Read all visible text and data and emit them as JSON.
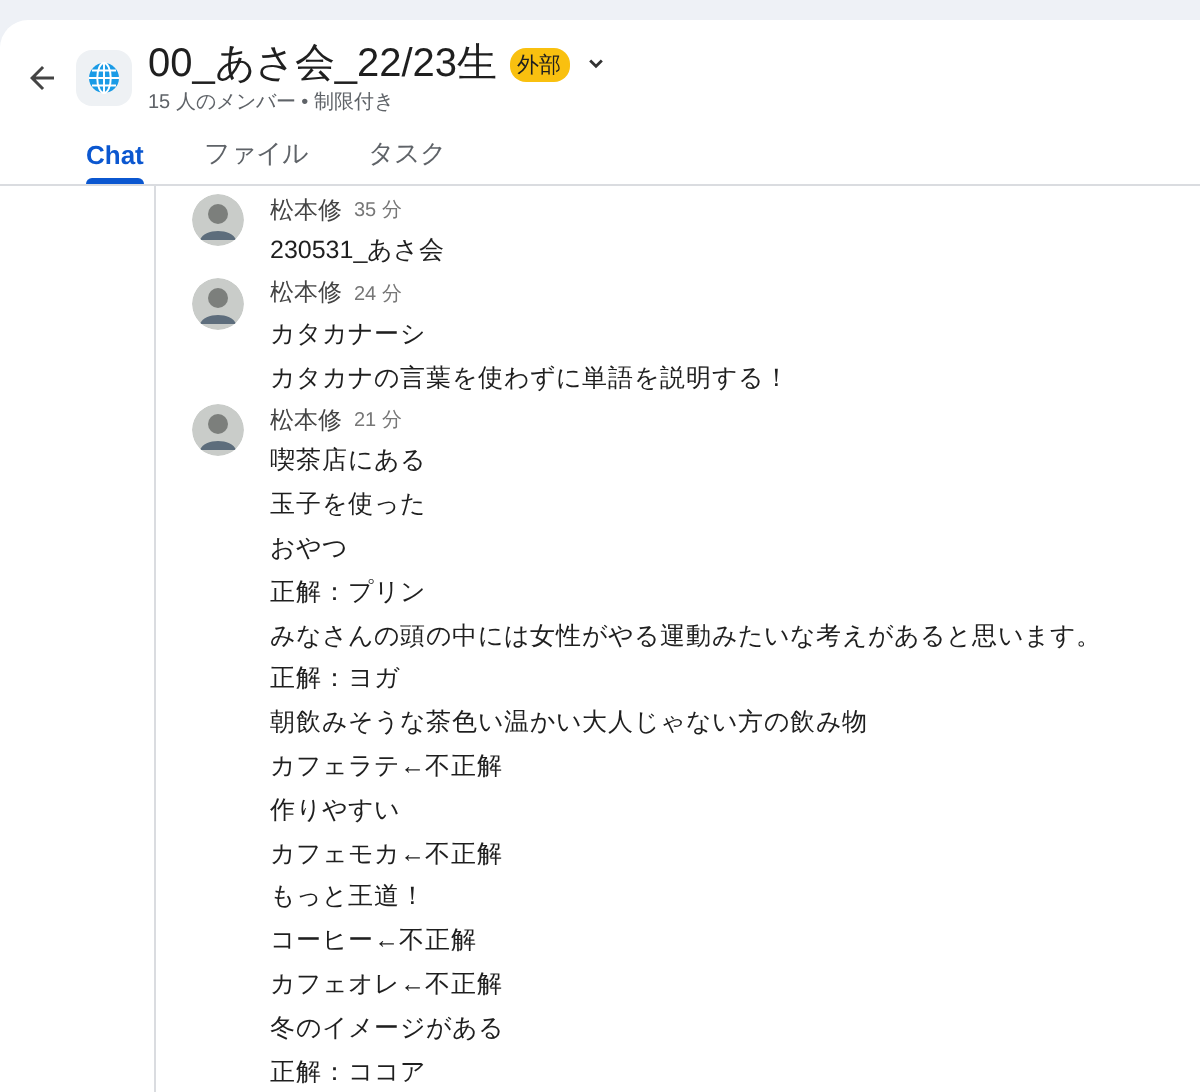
{
  "header": {
    "title": "00_あさ会_22/23生",
    "badge": "外部",
    "subtitle": "15 人のメンバー • 制限付き"
  },
  "tabs": [
    {
      "label": "Chat",
      "selected": true
    },
    {
      "label": "ファイル",
      "selected": false
    },
    {
      "label": "タスク",
      "selected": false
    }
  ],
  "messages": [
    {
      "author": "松本修",
      "time": "35 分",
      "lines": [
        "230531_あさ会"
      ]
    },
    {
      "author": "松本修",
      "time": "24 分",
      "lines": [
        "カタカナーシ",
        "カタカナの言葉を使わずに単語を説明する！"
      ]
    },
    {
      "author": "松本修",
      "time": "21 分",
      "lines": [
        "喫茶店にある",
        "玉子を使った",
        "おやつ",
        "正解：プリン",
        "みなさんの頭の中には女性がやる運動みたいな考えがあると思います。",
        "正解：ヨガ",
        "朝飲みそうな茶色い温かい大人じゃない方の飲み物",
        "カフェラテ←不正解",
        "作りやすい",
        "カフェモカ←不正解",
        "もっと王道！",
        "コーヒー←不正解",
        "カフェオレ←不正解",
        "冬のイメージがある",
        "正解：ココア"
      ]
    }
  ]
}
